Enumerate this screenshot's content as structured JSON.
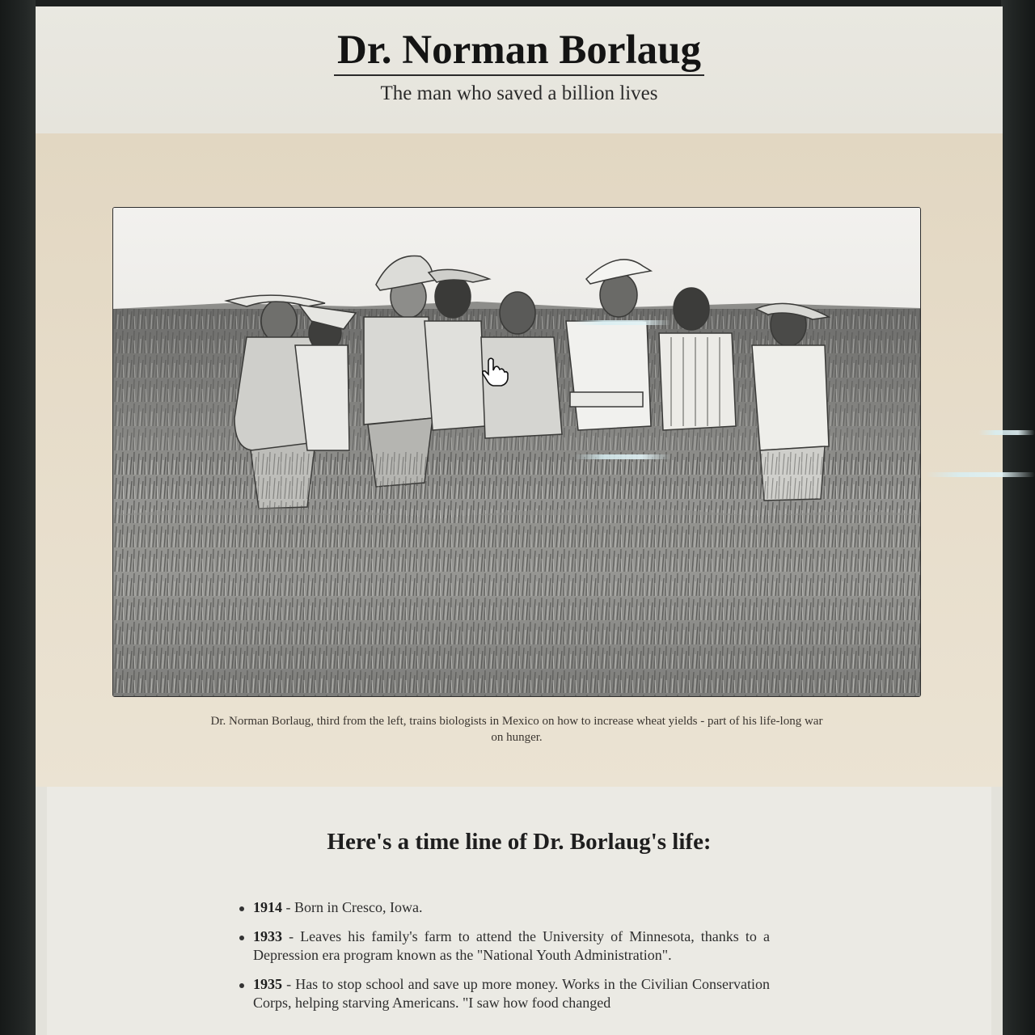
{
  "header": {
    "title": "Dr. Norman Borlaug",
    "subtitle": "The man who saved a billion lives"
  },
  "photo": {
    "description_icon": "wheat-field-photo",
    "caption": "Dr. Norman Borlaug, third from the left, trains biologists in Mexico on how to increase wheat yields - part of his life-long war on hunger."
  },
  "timeline": {
    "heading": "Here's a time line of Dr. Borlaug's life:",
    "items": [
      {
        "year": "1914",
        "text": " - Born in Cresco, Iowa."
      },
      {
        "year": "1933",
        "text": " - Leaves his family's farm to attend the University of Minnesota, thanks to a Depression era program known as the \"National Youth Administration\"."
      },
      {
        "year": "1935",
        "text": " - Has to stop school and save up more money. Works in the Civilian Conservation Corps, helping starving Americans. \"I saw how food changed"
      }
    ]
  },
  "colors": {
    "page_bg": "#ecebe4",
    "photo_band_bg": "#e2d7c2",
    "title_text": "#141414"
  }
}
